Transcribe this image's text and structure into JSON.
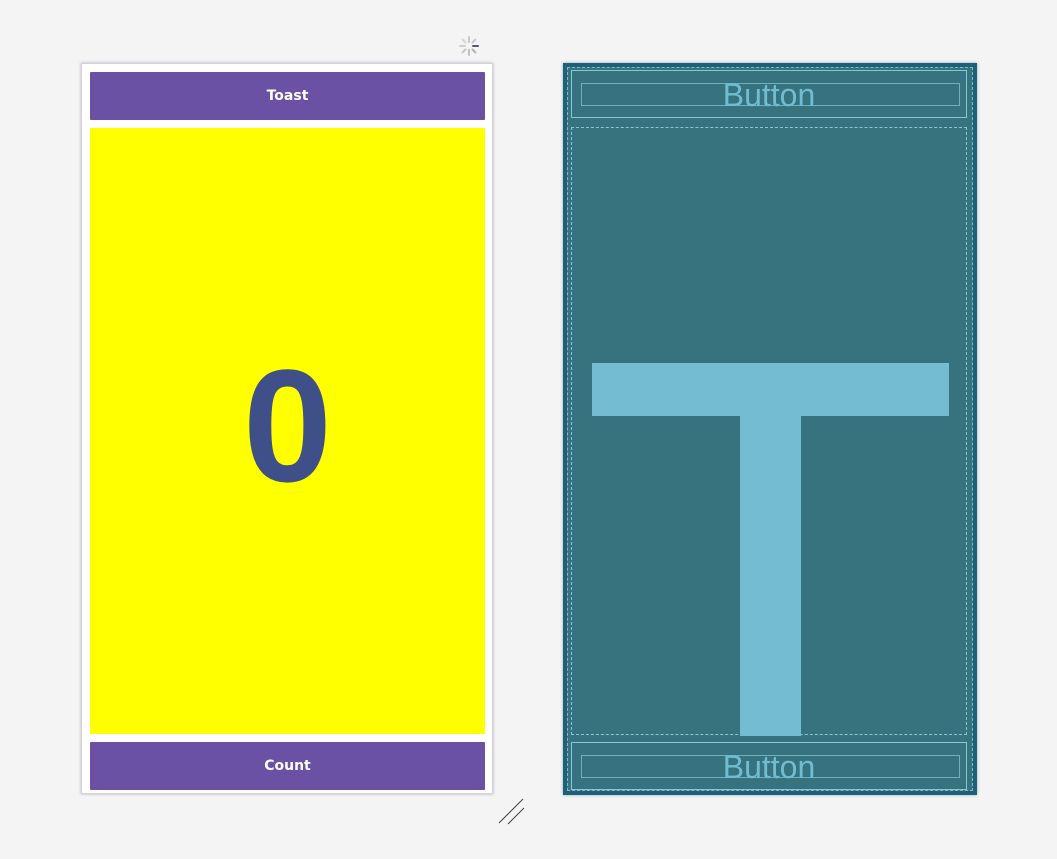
{
  "design_preview": {
    "toast_button_label": "Toast",
    "count_value": "0",
    "count_button_label": "Count",
    "colors": {
      "button": "#6a51a4",
      "count_background": "#ffff00",
      "count_text": "#3f4f87"
    }
  },
  "blueprint_preview": {
    "top_button_label": "Button",
    "bottom_button_label": "Button",
    "text_placeholder_icon": "text-view-icon",
    "colors": {
      "background": "#37737f",
      "outline": "#87c6d6",
      "label": "#74bcd2"
    }
  },
  "icons": {
    "loading": "loading-spinner-icon",
    "resize": "resize-handle-icon"
  }
}
